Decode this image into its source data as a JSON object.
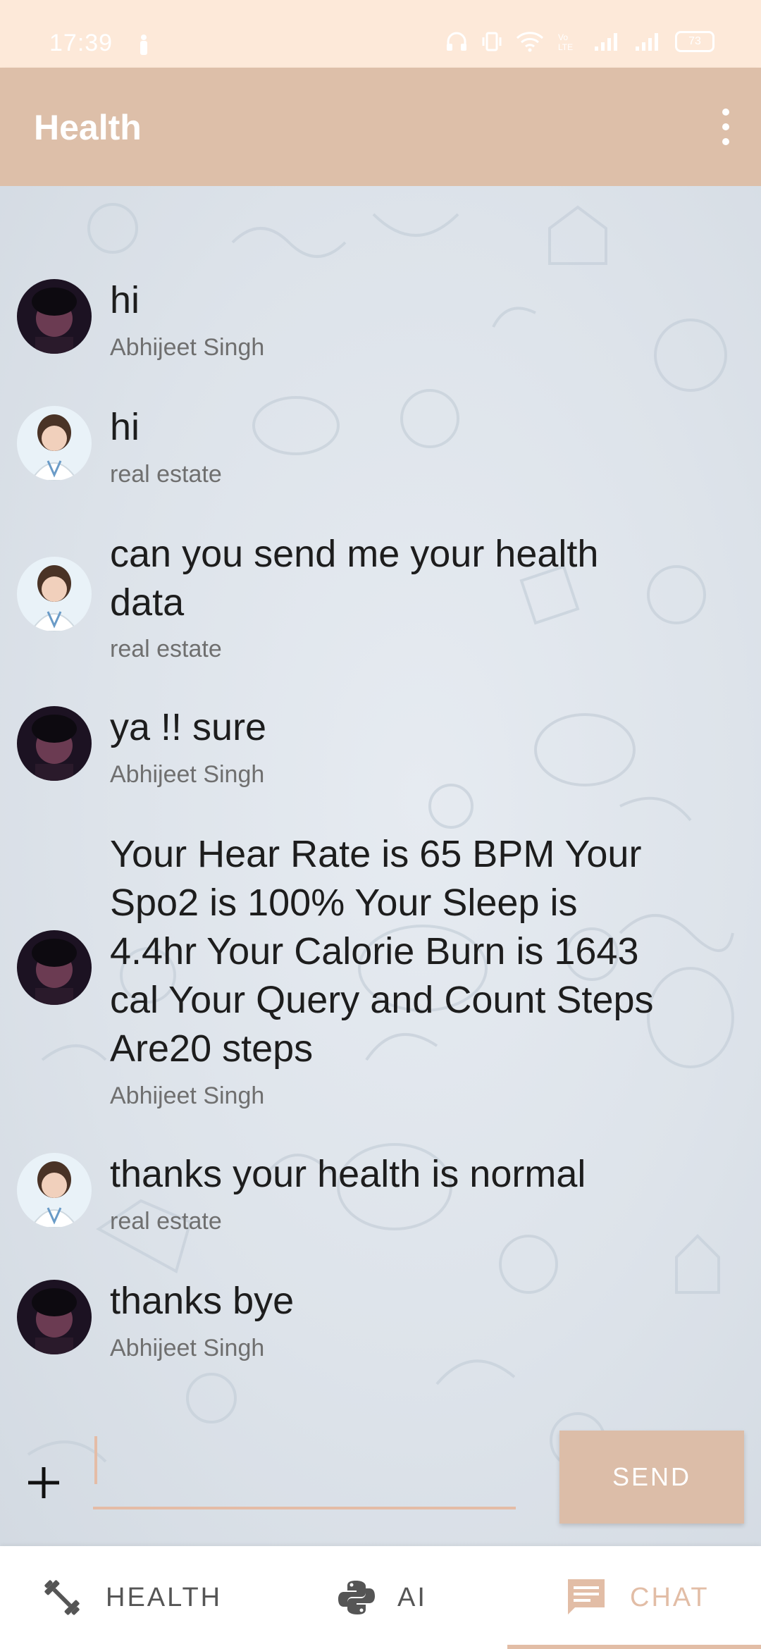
{
  "status_bar": {
    "time": "17:39",
    "battery": "73"
  },
  "app_bar": {
    "title": "Health",
    "menu_icon": "more-vert-icon"
  },
  "colors": {
    "header": "#ddbfa9",
    "status_bar": "#fde9d9",
    "accent": "#e2bda6",
    "send_button": "#dcbda8"
  },
  "messages": [
    {
      "text": "hi",
      "sender": "Abhijeet Singh",
      "avatar": "avatar-male"
    },
    {
      "text": "hi",
      "sender": "real estate",
      "avatar": "avatar-doctor"
    },
    {
      "text": "can you send me your health data",
      "sender": "real estate",
      "avatar": "avatar-doctor"
    },
    {
      "text": "ya !! sure",
      "sender": "Abhijeet Singh",
      "avatar": "avatar-male"
    },
    {
      "text": "Your Hear Rate is 65 BPM Your Spo2 is 100% Your Sleep is 4.4hr Your Calorie Burn is 1643 cal Your Query and Count Steps Are20 steps",
      "sender": "Abhijeet Singh",
      "avatar": "avatar-male"
    },
    {
      "text": "thanks your health is normal",
      "sender": "real estate",
      "avatar": "avatar-doctor"
    },
    {
      "text": "thanks bye",
      "sender": "Abhijeet Singh",
      "avatar": "avatar-male"
    }
  ],
  "composer": {
    "input_value": "",
    "send_label": "SEND",
    "attach_icon": "plus-icon"
  },
  "bottom_nav": {
    "items": [
      {
        "label": "HEALTH",
        "icon": "dumbbell-icon",
        "active": false
      },
      {
        "label": "AI",
        "icon": "python-icon",
        "active": false
      },
      {
        "label": "CHAT",
        "icon": "chat-icon",
        "active": true
      }
    ]
  }
}
